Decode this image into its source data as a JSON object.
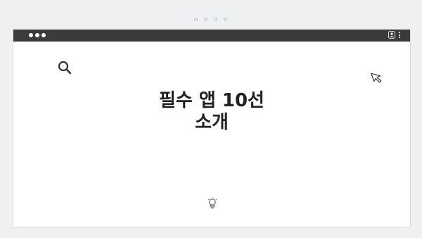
{
  "window": {
    "heading_line1": "필수 앱 10선",
    "heading_line2": "소개"
  },
  "icons": {
    "top_carousel": "pagination-dots",
    "user": "user-icon",
    "menu": "kebab-menu-icon",
    "search": "search-icon",
    "pointer": "cursor-icon",
    "idea": "lightbulb-icon"
  },
  "colors": {
    "titlebar": "#3a3b3c",
    "page_background": "#eef0f2",
    "window_background": "#ffffff"
  }
}
